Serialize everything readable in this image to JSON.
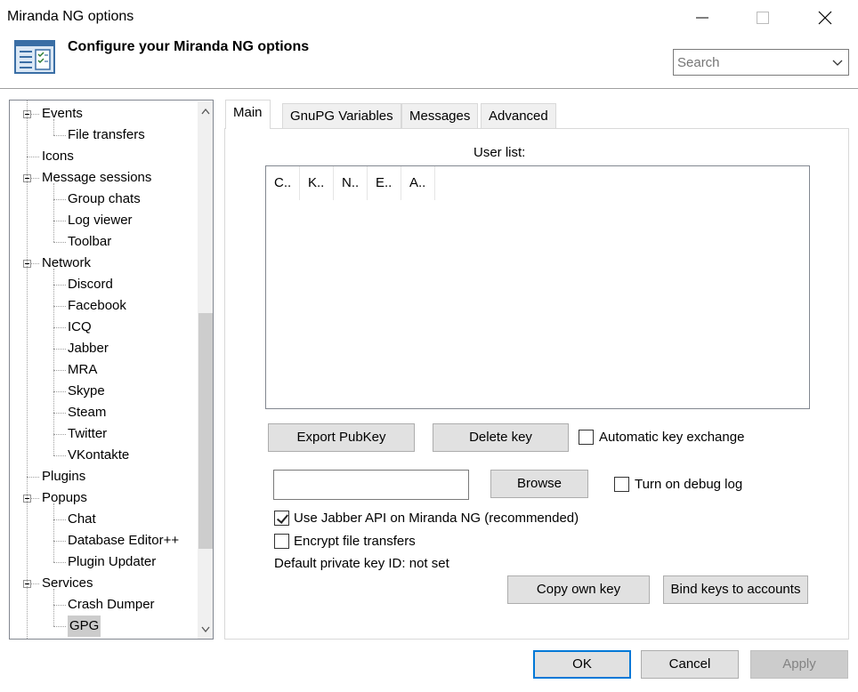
{
  "window": {
    "title": "Miranda NG options",
    "controls": [
      "minimize-icon",
      "maximize-icon",
      "close-icon"
    ]
  },
  "header": {
    "title": "Configure your Miranda NG options",
    "icon": "options-list-icon",
    "search": {
      "placeholder": "Search",
      "value": ""
    }
  },
  "tree": {
    "items": [
      {
        "label": "Events",
        "level": 0,
        "expanded": true
      },
      {
        "label": "File transfers",
        "level": 1
      },
      {
        "label": "Icons",
        "level": 0
      },
      {
        "label": "Message sessions",
        "level": 0,
        "expanded": true
      },
      {
        "label": "Group chats",
        "level": 1
      },
      {
        "label": "Log viewer",
        "level": 1
      },
      {
        "label": "Toolbar",
        "level": 1
      },
      {
        "label": "Network",
        "level": 0,
        "expanded": true
      },
      {
        "label": "Discord",
        "level": 1
      },
      {
        "label": "Facebook",
        "level": 1
      },
      {
        "label": "ICQ",
        "level": 1
      },
      {
        "label": "Jabber",
        "level": 1
      },
      {
        "label": "MRA",
        "level": 1
      },
      {
        "label": "Skype",
        "level": 1
      },
      {
        "label": "Steam",
        "level": 1
      },
      {
        "label": "Twitter",
        "level": 1
      },
      {
        "label": "VKontakte",
        "level": 1
      },
      {
        "label": "Plugins",
        "level": 0
      },
      {
        "label": "Popups",
        "level": 0,
        "expanded": true
      },
      {
        "label": "Chat",
        "level": 1
      },
      {
        "label": "Database Editor++",
        "level": 1
      },
      {
        "label": "Plugin Updater",
        "level": 1
      },
      {
        "label": "Services",
        "level": 0,
        "expanded": true
      },
      {
        "label": "Crash Dumper",
        "level": 1
      },
      {
        "label": "GPG",
        "level": 1,
        "selected": true
      }
    ]
  },
  "tabs": [
    {
      "label": "Main",
      "active": true
    },
    {
      "label": "GnuPG Variables"
    },
    {
      "label": "Messages"
    },
    {
      "label": "Advanced"
    }
  ],
  "main": {
    "user_list_label": "User list:",
    "columns": [
      "C..",
      "K..",
      "N..",
      "E..",
      "A.."
    ],
    "export_pubkey": "Export PubKey",
    "delete_key": "Delete key",
    "auto_key_exchange": {
      "label": "Automatic key exchange",
      "checked": false
    },
    "file_path": "",
    "browse": "Browse",
    "debug_log": {
      "label": "Turn on debug log",
      "checked": false
    },
    "use_jabber_api": {
      "label": "Use Jabber API on Miranda NG (recommended)",
      "checked": true
    },
    "encrypt_files": {
      "label": "Encrypt file transfers",
      "checked": false
    },
    "default_key_text": "Default private key ID: not set",
    "copy_own_key": "Copy own key",
    "bind_keys": "Bind keys to accounts"
  },
  "footer": {
    "ok": "OK",
    "cancel": "Cancel",
    "apply": "Apply"
  },
  "colors": {
    "accent": "#0078d7",
    "selection": "#cccccc"
  }
}
